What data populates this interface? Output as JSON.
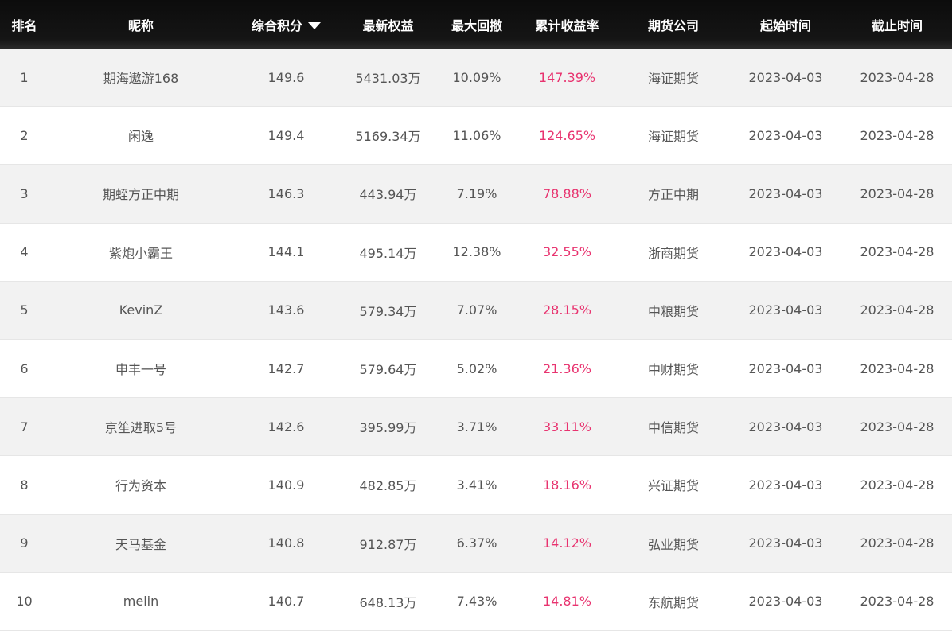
{
  "header": {
    "rank": "排名",
    "nickname": "昵称",
    "score": "综合积分",
    "equity": "最新权益",
    "drawdown": "最大回撤",
    "return": "累计收益率",
    "company": "期货公司",
    "start": "起始时间",
    "end": "截止时间"
  },
  "sort": {
    "column": "综合积分",
    "direction": "descending",
    "icon": "sort-down-icon"
  },
  "colors": {
    "header_bg": "#111111",
    "return_text": "#e8336f",
    "row_alt": "#f2f2f2"
  },
  "rows": [
    {
      "rank": "1",
      "nickname": "期海遨游168",
      "score": "149.6",
      "equity": "5431.03万",
      "drawdown": "10.09%",
      "return": "147.39%",
      "company": "海证期货",
      "start": "2023-04-03",
      "end": "2023-04-28"
    },
    {
      "rank": "2",
      "nickname": "闲逸",
      "score": "149.4",
      "equity": "5169.34万",
      "drawdown": "11.06%",
      "return": "124.65%",
      "company": "海证期货",
      "start": "2023-04-03",
      "end": "2023-04-28"
    },
    {
      "rank": "3",
      "nickname": "期蛭方正中期",
      "score": "146.3",
      "equity": "443.94万",
      "drawdown": "7.19%",
      "return": "78.88%",
      "company": "方正中期",
      "start": "2023-04-03",
      "end": "2023-04-28"
    },
    {
      "rank": "4",
      "nickname": "紫炮小霸王",
      "score": "144.1",
      "equity": "495.14万",
      "drawdown": "12.38%",
      "return": "32.55%",
      "company": "浙商期货",
      "start": "2023-04-03",
      "end": "2023-04-28"
    },
    {
      "rank": "5",
      "nickname": "KevinZ",
      "score": "143.6",
      "equity": "579.34万",
      "drawdown": "7.07%",
      "return": "28.15%",
      "company": "中粮期货",
      "start": "2023-04-03",
      "end": "2023-04-28"
    },
    {
      "rank": "6",
      "nickname": "申丰一号",
      "score": "142.7",
      "equity": "579.64万",
      "drawdown": "5.02%",
      "return": "21.36%",
      "company": "中财期货",
      "start": "2023-04-03",
      "end": "2023-04-28"
    },
    {
      "rank": "7",
      "nickname": "京笙进取5号",
      "score": "142.6",
      "equity": "395.99万",
      "drawdown": "3.71%",
      "return": "33.11%",
      "company": "中信期货",
      "start": "2023-04-03",
      "end": "2023-04-28"
    },
    {
      "rank": "8",
      "nickname": "行为资本",
      "score": "140.9",
      "equity": "482.85万",
      "drawdown": "3.41%",
      "return": "18.16%",
      "company": "兴证期货",
      "start": "2023-04-03",
      "end": "2023-04-28"
    },
    {
      "rank": "9",
      "nickname": "天马基金",
      "score": "140.8",
      "equity": "912.87万",
      "drawdown": "6.37%",
      "return": "14.12%",
      "company": "弘业期货",
      "start": "2023-04-03",
      "end": "2023-04-28"
    },
    {
      "rank": "10",
      "nickname": "melin",
      "score": "140.7",
      "equity": "648.13万",
      "drawdown": "7.43%",
      "return": "14.81%",
      "company": "东航期货",
      "start": "2023-04-03",
      "end": "2023-04-28"
    }
  ]
}
